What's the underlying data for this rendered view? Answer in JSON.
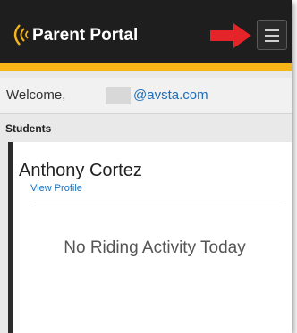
{
  "header": {
    "brand_title": "Parent Portal",
    "logo_icon": "signal-waves-icon",
    "arrow_icon": "red-arrow-right-icon",
    "menu_icon": "hamburger-menu-icon",
    "colors": {
      "background": "#1e1e1e",
      "accent": "#f6b418",
      "arrow": "#e5242a"
    }
  },
  "welcome": {
    "greeting": "Welcome,",
    "email_domain": "@avsta.com"
  },
  "students_section": {
    "label": "Students"
  },
  "student_card": {
    "name": "Anthony Cortez",
    "view_profile_label": "View Profile",
    "status_message": "No Riding Activity Today"
  }
}
